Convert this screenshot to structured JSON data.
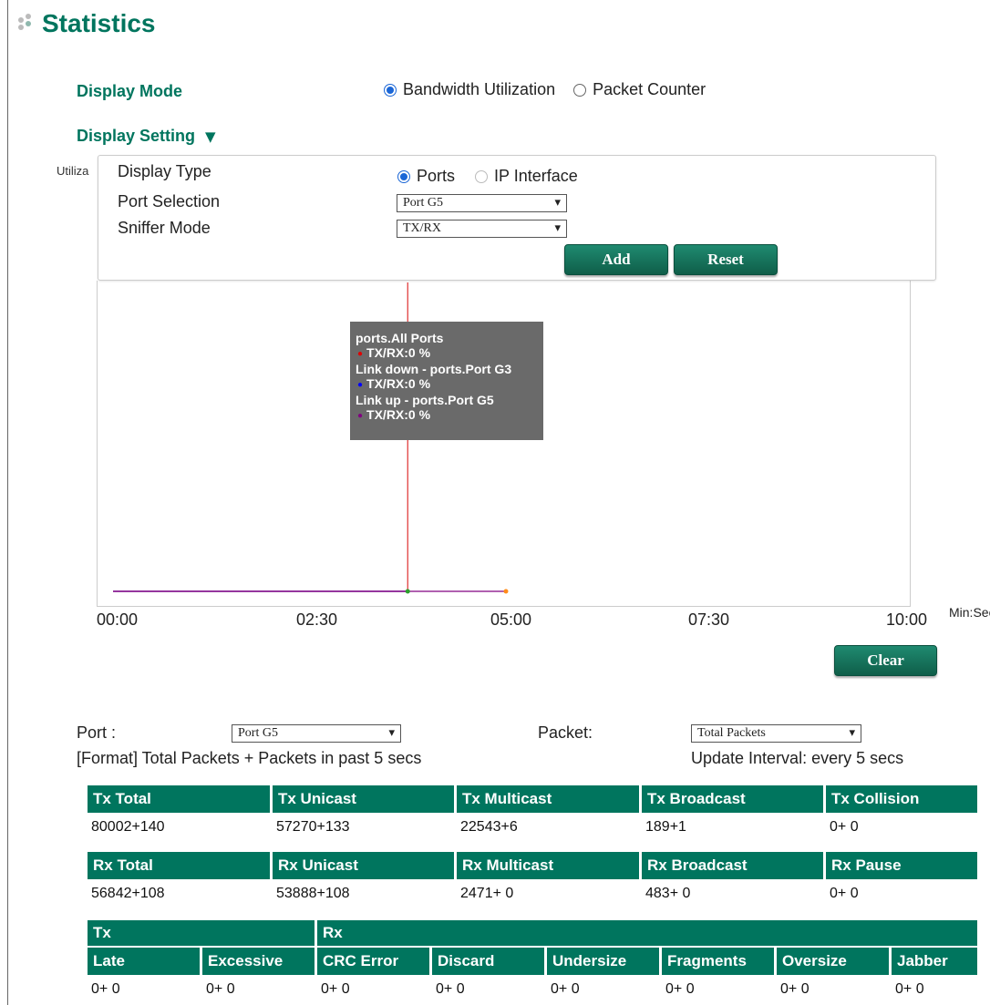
{
  "page": {
    "title": "Statistics"
  },
  "display_mode": {
    "label": "Display Mode",
    "options": [
      {
        "label": "Bandwidth Utilization",
        "selected": true
      },
      {
        "label": "Packet Counter",
        "selected": false
      }
    ]
  },
  "display_setting": {
    "label": "Display Setting",
    "toggle_icon": "triangle-down-icon",
    "display_type": {
      "label": "Display Type",
      "options": [
        {
          "label": "Ports",
          "selected": true,
          "disabled": false
        },
        {
          "label": "IP Interface",
          "selected": false,
          "disabled": true
        }
      ]
    },
    "port_selection": {
      "label": "Port Selection",
      "value": "Port G5"
    },
    "sniffer_mode": {
      "label": "Sniffer Mode",
      "value": "TX/RX"
    },
    "add_label": "Add",
    "reset_label": "Reset"
  },
  "chart": {
    "ylabel_partial": "Utiliza",
    "x_unit": "Min:Sec",
    "x_ticks": [
      "00:00",
      "02:30",
      "05:00",
      "07:30",
      "10:00"
    ],
    "tooltip": [
      {
        "title": "ports.All Ports",
        "line": "TX/RX:0 %",
        "color": "#e00000"
      },
      {
        "title": "Link down - ports.Port G3",
        "line": "TX/RX:0 %",
        "color": "#0000ff"
      },
      {
        "title": "Link up - ports.Port G5",
        "line": "TX/RX:0 %",
        "color": "#800080"
      }
    ],
    "clear_label": "Clear"
  },
  "chart_data": {
    "type": "line",
    "xlabel": "Min:Sec",
    "ylabel": "Utiliza",
    "x_ticks": [
      "00:00",
      "02:30",
      "05:00",
      "07:30",
      "10:00"
    ],
    "xlim": [
      0,
      600
    ],
    "series": [
      {
        "name": "ports.All Ports",
        "color": "#e00000",
        "x": [
          0,
          225
        ],
        "y": [
          0,
          0
        ]
      },
      {
        "name": "Link down - ports.Port G3",
        "color": "#0000ff",
        "x": [
          0,
          225
        ],
        "y": [
          0,
          0
        ]
      },
      {
        "name": "Link up - ports.Port G5",
        "color": "#800080",
        "x": [
          0,
          300
        ],
        "y": [
          0,
          0
        ]
      }
    ],
    "cursor_x": 225
  },
  "packet_counter": {
    "port_label": "Port :",
    "port_value": "Port G5",
    "packet_label": "Packet:",
    "packet_value": "Total Packets",
    "format_text": "[Format] Total Packets + Packets in past 5 secs",
    "interval_text": "Update Interval: every 5 secs"
  },
  "tx_table": {
    "headers": [
      "Tx Total",
      "Tx Unicast",
      "Tx Multicast",
      "Tx Broadcast",
      "Tx Collision"
    ],
    "values": [
      "80002+140",
      "57270+133",
      "22543+6",
      "189+1",
      "0+ 0"
    ]
  },
  "rx_table": {
    "headers": [
      "Rx Total",
      "Rx Unicast",
      "Rx Multicast",
      "Rx Broadcast",
      "Rx Pause"
    ],
    "values": [
      "56842+108",
      "53888+108",
      "2471+ 0",
      "483+ 0",
      "0+ 0"
    ]
  },
  "err_table": {
    "group_tx": "Tx",
    "group_rx": "Rx",
    "headers": [
      "Late",
      "Excessive",
      "CRC Error",
      "Discard",
      "Undersize",
      "Fragments",
      "Oversize",
      "Jabber"
    ],
    "values": [
      "0+ 0",
      "0+ 0",
      "0+ 0",
      "0+ 0",
      "0+ 0",
      "0+ 0",
      "0+ 0",
      "0+ 0"
    ]
  }
}
